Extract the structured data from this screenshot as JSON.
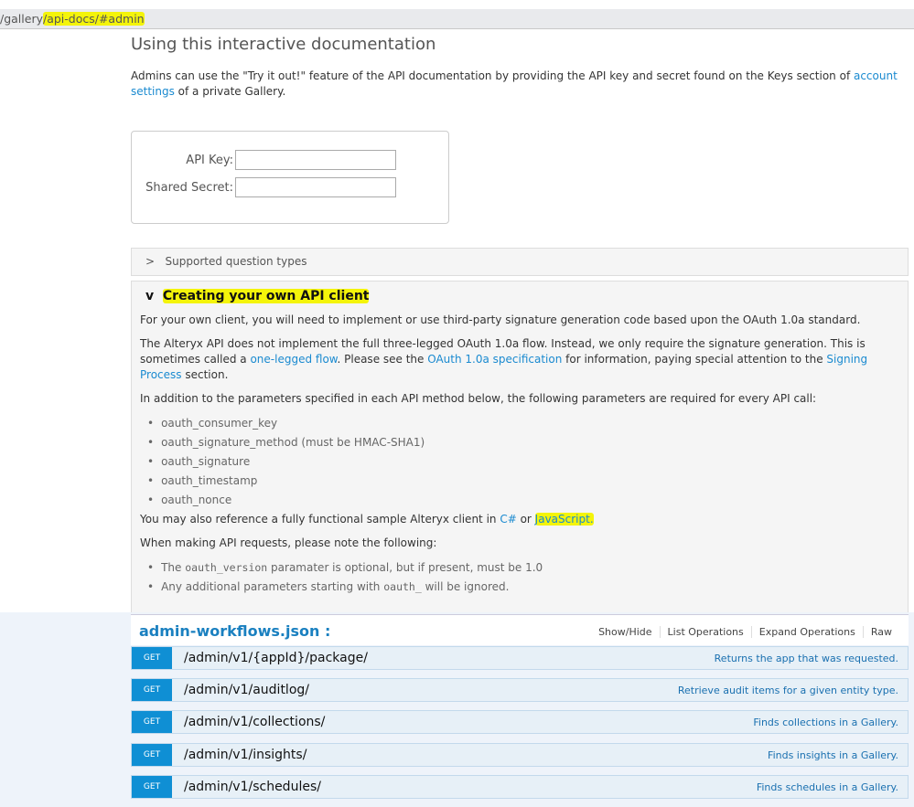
{
  "url": {
    "prefix": "/gallery",
    "highlighted": "/api-docs/#admin"
  },
  "title": "Using this interactive documentation",
  "intro": {
    "text": "Admins can use the \"Try it out!\" feature of the API documentation by providing the API key and secret found on the Keys section of ",
    "link": "account settings",
    "after": " of a private Gallery."
  },
  "keys": {
    "api_key_label": "API Key:",
    "secret_label": "Shared Secret:",
    "api_key_value": "",
    "secret_value": ""
  },
  "supported": {
    "arrow": ">",
    "label": "Supported question types"
  },
  "client": {
    "arrow": "v",
    "title": "Creating your own API client",
    "p1": "For your own client, you will need to implement or use third-party signature generation code based upon the OAuth 1.0a standard.",
    "p2a": "The Alteryx API does not implement the full three-legged OAuth 1.0a flow. Instead, we only require the signature generation. This is sometimes called a ",
    "p2link1": "one-legged flow",
    "p2b": ". Please see the ",
    "p2link2": "OAuth 1.0a specification",
    "p2c": " for information, paying special attention to the ",
    "p2link3": "Signing Process",
    "p2d": " section.",
    "p3": "In addition to the parameters specified in each API method below, the following parameters are required for every API call:",
    "params": [
      "oauth_consumer_key",
      "oauth_signature_method (must be HMAC-SHA1)",
      "oauth_signature",
      "oauth_timestamp",
      "oauth_nonce"
    ],
    "p4a": "You may also reference a fully functional sample Alteryx client in ",
    "p4link1": "C#",
    "p4b": " or ",
    "p4link2": "JavaScript.",
    "p5": "When making API requests, please note the following:",
    "note1a": "The ",
    "note1code": "oauth_version",
    "note1b": " paramater is optional, but if present, must be 1.0",
    "note2a": "Any additional parameters starting with ",
    "note2code": "oauth_",
    "note2b": " will be ignored."
  },
  "resource": {
    "title": "admin-workflows.json :",
    "ops": [
      "Show/Hide",
      "List Operations",
      "Expand Operations",
      "Raw"
    ],
    "endpoints": [
      {
        "method": "GET",
        "path": "/admin/v1/{appId}/package/",
        "desc": "Returns the app that was requested."
      },
      {
        "method": "GET",
        "path": "/admin/v1/auditlog/",
        "desc": "Retrieve audit items for a given entity type."
      },
      {
        "method": "GET",
        "path": "/admin/v1/collections/",
        "desc": "Finds collections in a Gallery."
      },
      {
        "method": "GET",
        "path": "/admin/v1/insights/",
        "desc": "Finds insights in a Gallery."
      },
      {
        "method": "GET",
        "path": "/admin/v1/schedules/",
        "desc": "Finds schedules in a Gallery."
      }
    ]
  },
  "colors": {
    "link": "#1a8ad0",
    "get": "#0f8fd4",
    "highlight": "#f4f40a"
  }
}
